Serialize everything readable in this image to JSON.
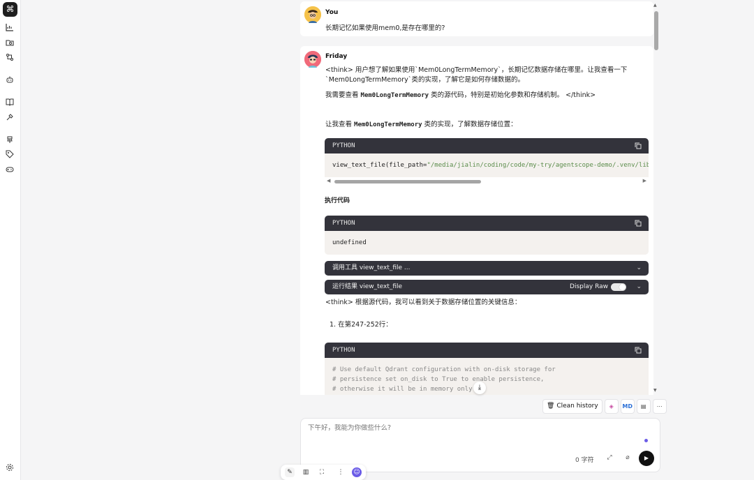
{
  "app": {
    "logo": "⌘"
  },
  "rail_icons": [
    "chart-icon",
    "folder-search-icon",
    "flow-icon",
    "robot-icon",
    "book-icon",
    "tools-icon",
    "pin-icon",
    "tag-icon",
    "gamepad-icon",
    "settings-icon"
  ],
  "user_msg": {
    "author": "You",
    "text": "长期记忆如果使用mem0,是存在哪里的?"
  },
  "bot_msg": {
    "author": "Friday",
    "line1": "<think> 用户想了解如果使用`Mem0LongTermMemory`，长期记忆数据存储在哪里。让我查看一下",
    "line2": "`Mem0LongTermMemory`类的实现，了解它是如何存储数据的。",
    "line3_pre": "我需要查看 ",
    "line3_code": "Mem0LongTermMemory",
    "line3_post": " 类的源代码，特别是初始化参数和存储机制。 </think>",
    "line4_pre": "让我查看 ",
    "line4_code": "Mem0LongTermMemory",
    "line4_post": " 类的实现，了解数据存储位置：",
    "code1_lang": "PYTHON",
    "code1_fn": "view_text_file(file_path=",
    "code1_str": "\"/media/jialin/coding/code/my-try/agentscope-demo/.venv/lib/p",
    "exec_heading": "执行代码",
    "code2_lang": "PYTHON",
    "code2_text": "undefined",
    "tool_call": "调用工具 view_text_file ...",
    "tool_result": "运行结果 view_text_file",
    "display_raw": "Display Raw",
    "think2": "<think> 根据源代码，我可以看到关于数据存储位置的关键信息：",
    "list_item": "1. 在第247-252行：",
    "code3_lang": "PYTHON",
    "code3_lines": [
      "# Use default Qdrant configuration with on-disk storage for",
      "# persistence set on_disk to True to enable persistence,",
      "# otherwise it will be in memory only"
    ]
  },
  "toolbar": {
    "clean_history": "Clean history",
    "md": "MD",
    "more": "⋯"
  },
  "input": {
    "placeholder": "下午好，我能为你做些什么?",
    "counter": "0 字符"
  }
}
